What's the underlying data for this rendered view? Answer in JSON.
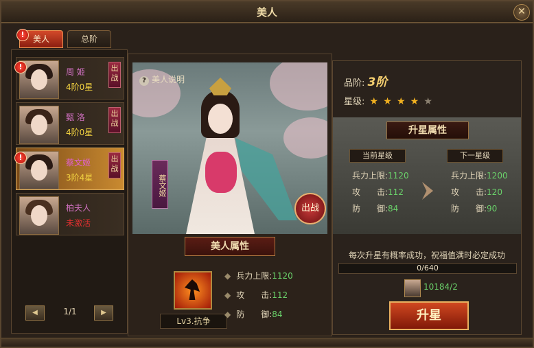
{
  "window": {
    "title": "美人",
    "close_icon": "close-icon"
  },
  "tabs": [
    {
      "label": "美人",
      "active": true
    },
    {
      "label": "总阶",
      "active": false
    }
  ],
  "beauties": [
    {
      "name": "周 姬",
      "rank": "4阶0星",
      "battle": "出战",
      "alert": "!",
      "active": true
    },
    {
      "name": "甄 洛",
      "rank": "4阶0星",
      "battle": "出战",
      "alert": "",
      "active": true
    },
    {
      "name": "蔡文姬",
      "rank": "3阶4星",
      "battle": "出战",
      "alert": "!",
      "active": true,
      "selected": true
    },
    {
      "name": "柏夫人",
      "rank": "未激活",
      "battle": "",
      "alert": "",
      "active": false
    }
  ],
  "pager": {
    "text": "1/1",
    "prev_icon": "prev-icon",
    "next_icon": "next-icon"
  },
  "center": {
    "info_link": "美人说明",
    "vertical_name": "蔡文姬",
    "deploy_label": "出战",
    "section_title": "美人属性",
    "skill_level": "Lv3.抗争",
    "attributes": [
      {
        "label": "兵力上限:",
        "value": "1120"
      },
      {
        "label": "攻　　击:",
        "value": "112"
      },
      {
        "label": "防　　御:",
        "value": "84"
      }
    ]
  },
  "right": {
    "rank_label": "品阶:",
    "rank_value": "3阶",
    "star_label": "星级:",
    "stars_lit": 4,
    "stars_total": 5,
    "upgrade_title": "升星属性",
    "current_label": "当前星级",
    "next_label": "下一星级",
    "current": [
      {
        "label": "兵力上限:",
        "value": "1120"
      },
      {
        "label": "攻　　击:",
        "value": "112"
      },
      {
        "label": "防　　御:",
        "value": "84"
      }
    ],
    "next": [
      {
        "label": "兵力上限:",
        "value": "1200"
      },
      {
        "label": "攻　　击:",
        "value": "120"
      },
      {
        "label": "防　　御:",
        "value": "90"
      }
    ],
    "note": "每次升星有概率成功，祝福值满时必定成功",
    "progress_text": "0/640",
    "progress_fraction": 0,
    "item_count": "10184/2",
    "upgrade_button": "升星"
  }
}
